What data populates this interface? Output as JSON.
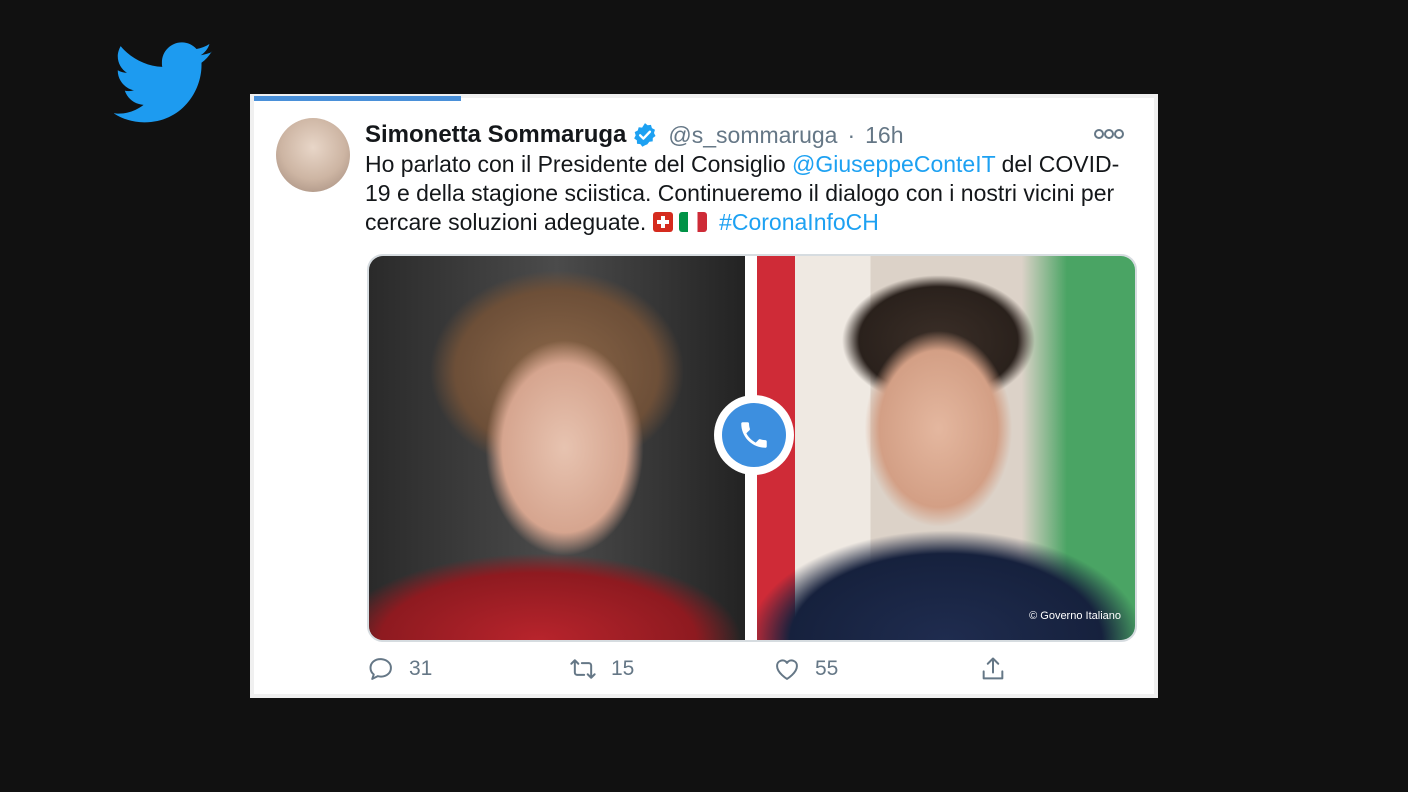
{
  "tweet": {
    "author_name": "Simonetta Sommaruga",
    "handle": "@s_sommaruga",
    "separator": "·",
    "time": "16h",
    "text_part1": "Ho parlato con il Presidente del Consiglio ",
    "mention": "@GiuseppeConteIT",
    "text_part2": " del COVID-19 e della stagione sciistica. Continueremo il dialogo con i nostri vicini per cercare soluzioni adeguate. ",
    "hashtag": "#CoronaInfoCH",
    "media_credit": "© Governo Italiano",
    "progress_fraction": 0.23
  },
  "actions": {
    "reply_count": "31",
    "retweet_count": "15",
    "like_count": "55"
  },
  "colors": {
    "link": "#1da1f2",
    "verified": "#1da1f2",
    "twitter_bird": "#1d9bf0",
    "call_button": "#3d8fdf"
  },
  "icons": [
    "twitter-bird-icon",
    "verified-badge-icon",
    "more-options-icon",
    "phone-icon",
    "reply-icon",
    "retweet-icon",
    "like-icon",
    "share-icon",
    "swiss-flag-icon",
    "italian-flag-icon"
  ]
}
